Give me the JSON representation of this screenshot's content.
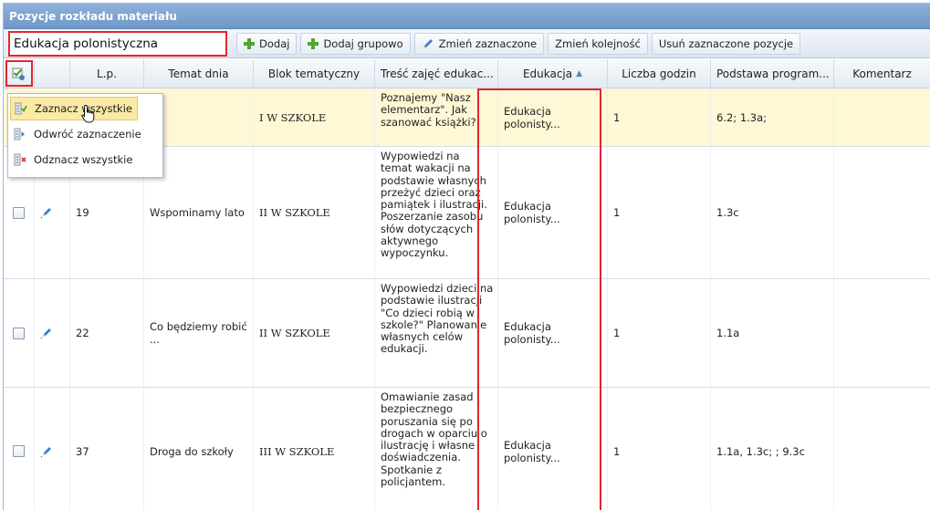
{
  "panel": {
    "title": "Pozycje rozkładu materiału"
  },
  "toolbar": {
    "filter_value": "Edukacja polonistyczna",
    "add_label": "Dodaj",
    "add_group_label": "Dodaj grupowo",
    "change_selected_label": "Zmień zaznaczone",
    "change_order_label": "Zmień kolejność",
    "remove_selected_label": "Usuń zaznaczone pozycje"
  },
  "grid": {
    "columns": {
      "lp": "L.p.",
      "topic": "Temat dnia",
      "block": "Blok tematyczny",
      "content": "Treść zajęć edukac...",
      "education": "Edukacja",
      "hours": "Liczba godzin",
      "basis": "Podstawa program...",
      "comment": "Komentarz"
    },
    "sort": {
      "column": "Edukacja",
      "direction": "ascending"
    },
    "rows": [
      {
        "lp": "",
        "topic": "ła",
        "block": "I W SZKOLE",
        "content": "Poznajemy \"Nasz elementarz\". Jak szanować książki?",
        "education": "Edukacja polonisty...",
        "hours": "1",
        "basis": "6.2; 1.3a;",
        "comment": ""
      },
      {
        "lp": "19",
        "topic": "Wspominamy lato",
        "block": "II W SZKOLE",
        "content": "Wypowiedzi na temat wakacji na podstawie własnych przeżyć dzieci oraz pamiątek i ilustracji. Poszerzanie zasobu słów dotyczących aktywnego wypoczynku.",
        "education": "Edukacja polonisty...",
        "hours": "1",
        "basis": "1.3c",
        "comment": ""
      },
      {
        "lp": "22",
        "topic": "Co będziemy robić ...",
        "block": "II W SZKOLE",
        "content": "Wypowiedzi dzieci na podstawie ilustracji \"Co dzieci robią w szkole?\" Planowanie własnych celów edukacji.",
        "education": "Edukacja polonisty...",
        "hours": "1",
        "basis": "1.1a",
        "comment": ""
      },
      {
        "lp": "37",
        "topic": "Droga do szkoły",
        "block": "III W SZKOLE",
        "content": "Omawianie zasad bezpiecznego poruszania się po drogach w oparciu o ilustrację i własne doświadczenia. Spotkanie z policjantem.",
        "education": "Edukacja polonisty...",
        "hours": "1",
        "basis": "1.1a, 1.3c; ; 9.3c",
        "comment": ""
      }
    ]
  },
  "select_menu": {
    "select_all": "Zaznacz wszystkie",
    "invert": "Odwróć zaznaczenie",
    "deselect_all": "Odznacz wszystkie"
  },
  "colors": {
    "highlight_border": "#e3262b",
    "header_blue": "#7aa0cf",
    "row_highlight": "#fff8d6"
  }
}
